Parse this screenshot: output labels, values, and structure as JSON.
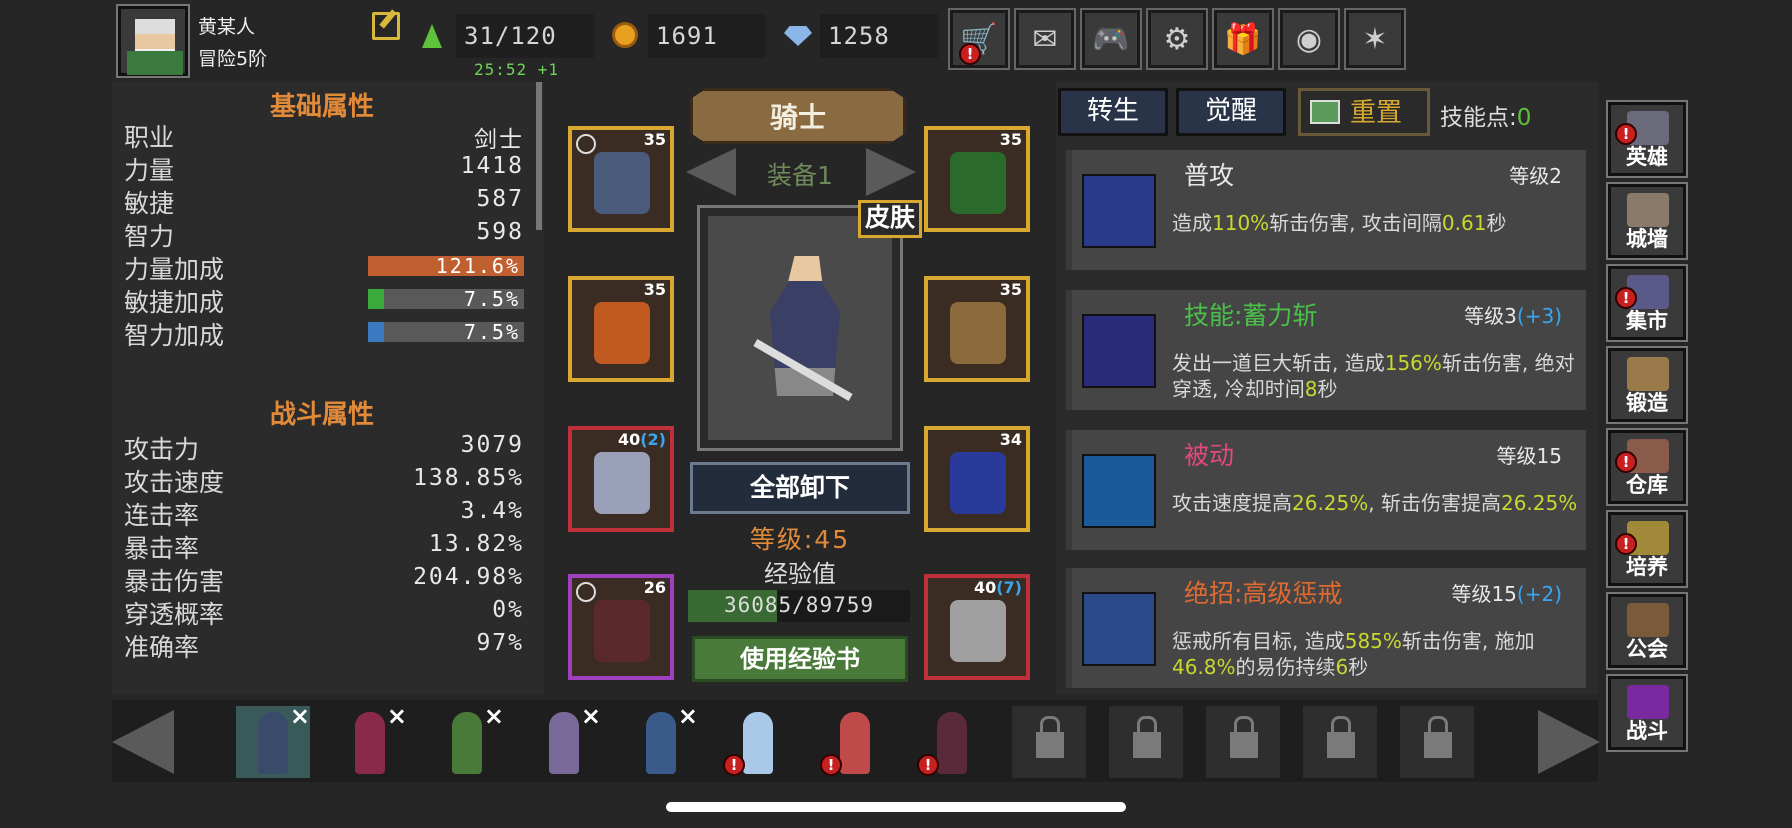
{
  "player": {
    "name": "黄某人",
    "rank": "冒险5阶"
  },
  "resources": {
    "energy": "31/120",
    "energy_timer": "25:52 +1",
    "gold": "1691",
    "gems": "1258"
  },
  "top_buttons": [
    "shop-cart-icon",
    "mail-icon",
    "gamepad-icon",
    "settings-gear-icon",
    "gift-icon",
    "lucky-wheel-icon",
    "fireworks-icon"
  ],
  "stats": {
    "basic_title": "基础属性",
    "combat_title": "战斗属性",
    "basic": [
      {
        "label": "职业",
        "value": "剑士"
      },
      {
        "label": "力量",
        "value": "1418"
      },
      {
        "label": "敏捷",
        "value": "587"
      },
      {
        "label": "智力",
        "value": "598"
      }
    ],
    "bonuses": [
      {
        "label": "力量加成",
        "value": "121.6%",
        "fill": 1.0,
        "color": "#c06030"
      },
      {
        "label": "敏捷加成",
        "value": "7.5%",
        "fill": 0.075,
        "color": "#3aaa3a"
      },
      {
        "label": "智力加成",
        "value": "7.5%",
        "fill": 0.075,
        "color": "#3a7ac0"
      }
    ],
    "combat": [
      {
        "label": "攻击力",
        "value": "3079"
      },
      {
        "label": "攻击速度",
        "value": "138.85%"
      },
      {
        "label": "连击率",
        "value": "3.4%"
      },
      {
        "label": "暴击率",
        "value": "13.82%"
      },
      {
        "label": "暴击伤害",
        "value": "204.98%"
      },
      {
        "label": "穿透概率",
        "value": "0%"
      },
      {
        "label": "准确率",
        "value": "97%"
      }
    ]
  },
  "equipment": {
    "class_name": "骑士",
    "set_label": "装备1",
    "skin_tag": "皮肤",
    "unequip_all": "全部卸下",
    "hero_level": "等级:45",
    "exp_label": "经验值",
    "exp_text": "36085/89759",
    "exp_fill": 0.402,
    "use_exp_book": "使用经验书",
    "slots": [
      {
        "name": "helmet-slot",
        "level": "35",
        "plus": ""
      },
      {
        "name": "amulet-slot",
        "level": "35",
        "plus": ""
      },
      {
        "name": "armor-slot",
        "level": "35",
        "plus": ""
      },
      {
        "name": "gloves-slot",
        "level": "35",
        "plus": ""
      },
      {
        "name": "leggings-slot",
        "level": "40",
        "plus": "(2)"
      },
      {
        "name": "ring-slot",
        "level": "34",
        "plus": ""
      },
      {
        "name": "boots-slot",
        "level": "26",
        "plus": ""
      },
      {
        "name": "weapon-slot",
        "level": "40",
        "plus": "(7)"
      }
    ]
  },
  "skill_tabs": {
    "rebirth": "转生",
    "awaken": "觉醒",
    "reset": "重置",
    "points_label": "技能点:",
    "points": "0"
  },
  "skills": [
    {
      "name": "普攻",
      "name_color": "#e8e8e8",
      "level": "等级2",
      "bonus": "",
      "desc_parts": [
        "造成",
        "110%",
        "斩击伤害, 攻击间隔",
        "0.61",
        "秒"
      ]
    },
    {
      "name": "技能:蓄力斩",
      "name_color": "#4ac04a",
      "level": "等级3",
      "bonus": "(+3)",
      "desc_parts": [
        "发出一道巨大斩击, 造成",
        "156%",
        "斩击伤害, 绝对穿透, 冷却时间",
        "8",
        "秒"
      ]
    },
    {
      "name": "被动",
      "name_color": "#e04a7a",
      "level": "等级15",
      "bonus": "",
      "desc_parts": [
        "攻击速度提高",
        "26.25%",
        ", 斩击伤害提高",
        "26.25%",
        ""
      ]
    },
    {
      "name": "绝招:高级惩戒",
      "name_color": "#e06a30",
      "level": "等级15",
      "bonus": "(+2)",
      "desc_parts": [
        "惩戒所有目标, 造成",
        "585%",
        "斩击伤害, 施加",
        "46.8%",
        "的易伤持续",
        "6",
        "秒"
      ]
    }
  ],
  "nav": [
    {
      "label": "英雄",
      "alert": true
    },
    {
      "label": "城墙",
      "alert": false
    },
    {
      "label": "集市",
      "alert": true
    },
    {
      "label": "锻造",
      "alert": false
    },
    {
      "label": "仓库",
      "alert": true
    },
    {
      "label": "培养",
      "alert": true
    },
    {
      "label": "公会",
      "alert": false
    },
    {
      "label": "战斗",
      "alert": false
    }
  ],
  "alert_mark": "!",
  "close_mark": "×"
}
